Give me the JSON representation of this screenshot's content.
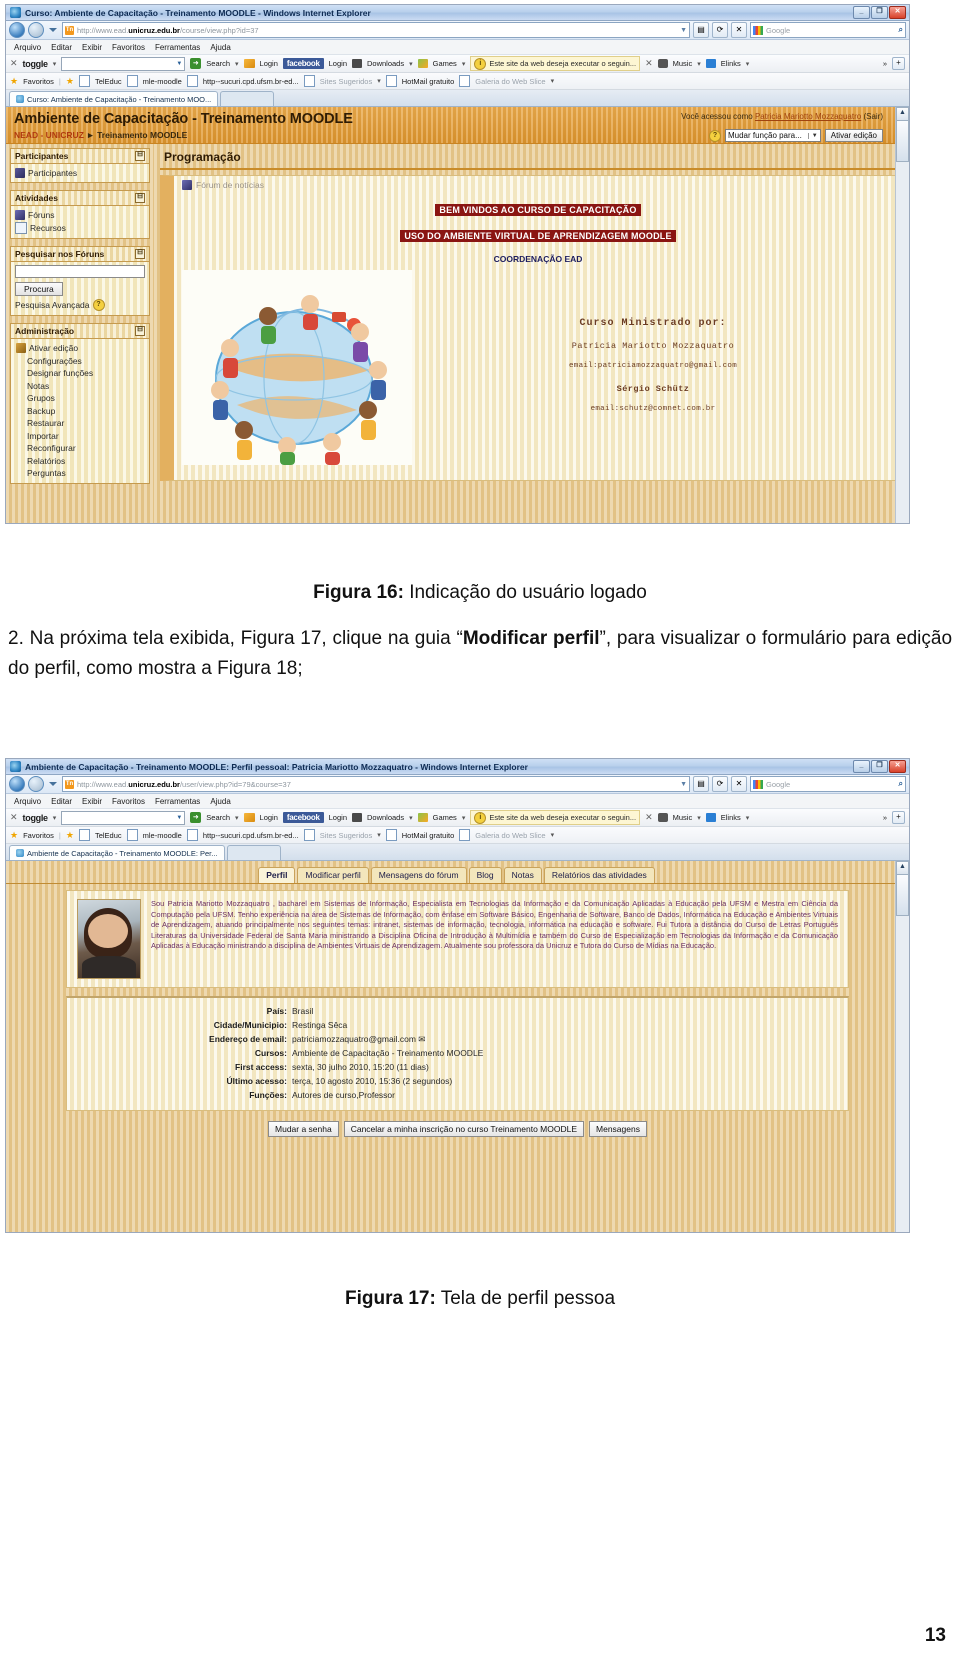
{
  "document": {
    "figure16_caption_bold": "Figura 16:",
    "figure16_caption_rest": " Indicação do usuário logado",
    "paragraph_part1": "2. Na próxima tela exibida, Figura 17, clique na guia “",
    "paragraph_bold": "Modificar perfil",
    "paragraph_part2": "”, para visualizar o formulário para edição do perfil, como mostra a Figura 18;",
    "figure17_caption_bold": "Figura 17:",
    "figure17_caption_rest": " Tela de perfil pessoa",
    "page_number": "13"
  },
  "shot1": {
    "window_title": "Curso: Ambiente de Capacitação - Treinamento MOODLE - Windows Internet Explorer",
    "win_minimize": "_",
    "win_restore": "❐",
    "win_close": "✕",
    "url_favicon": "Tn",
    "url_prefix": "http://www.ead.",
    "url_domain": "unicruz.edu.br",
    "url_suffix": "/course/view.php?id=37",
    "url_dropdown": "▼",
    "nav_refresh": "⟳",
    "nav_stop": "✕",
    "search_placeholder": "Google",
    "search_mag": "🔍",
    "menu": [
      "Arquivo",
      "Editar",
      "Exibir",
      "Favoritos",
      "Ferramentas",
      "Ajuda"
    ],
    "toolbar": {
      "close_x": "✕",
      "toggle_label": "toggle",
      "search_label": "Search",
      "login_label": "Login",
      "facebook_label": "facebook",
      "facebook_login_label": "Login",
      "downloads_label": "Downloads",
      "games_label": "Games",
      "notification": "Este site da web deseja executar o seguin...",
      "notification_close": "✕",
      "music_label": "Music",
      "elinks_label": "Elinks",
      "overflow": "»",
      "plus": "+"
    },
    "favbar": {
      "favorites_label": "Favoritos",
      "items": [
        "TelEduc",
        "mle-moodle",
        "http--sucuri.cpd.ufsm.br-ed...",
        "Sites Sugeridos",
        "HotMail gratuito",
        "Galeria do Web Slice"
      ]
    },
    "tab_label": "Curso: Ambiente de Capacitação - Treinamento MOO...",
    "moodle": {
      "site_title": "Ambiente de Capacitação - Treinamento MOODLE",
      "user_prefix": "Você acessou como ",
      "user_name": "Patricia Mariotto Mozzaquatro",
      "user_logout": " (Sair)",
      "breadcrumb_root": "NEAD - UNICRUZ",
      "breadcrumb_sep": "►",
      "breadcrumb_current": "Treinamento MOODLE",
      "help_icon": "?",
      "role_select": "Mudar função para...",
      "role_select_arrow": "▼",
      "edit_button": "Ativar edição",
      "blocks": [
        {
          "title": "Participantes",
          "minimize": "⊟",
          "items": [
            "Participantes"
          ]
        },
        {
          "title": "Atividades",
          "minimize": "⊟",
          "items": [
            "Fóruns",
            "Recursos"
          ]
        }
      ],
      "search_block": {
        "title": "Pesquisar nos Fóruns",
        "minimize": "⊟",
        "input_value": "",
        "button": "Procura",
        "advanced": "Pesquisa Avançada",
        "advanced_help": "?"
      },
      "admin_block": {
        "title": "Administração",
        "minimize": "⊟",
        "items": [
          "Ativar edição",
          "Configurações",
          "Designar funções",
          "Notas",
          "Grupos",
          "Backup",
          "Restaurar",
          "Importar",
          "Reconfigurar",
          "Relatórios",
          "Perguntas"
        ]
      },
      "section_title": "Programação",
      "news_forum": "Fórum de notícias",
      "banner1": "BEM VINDOS AO CURSO DE CAPACITAÇÃO",
      "banner2": "USO DO AMBIENTE VIRTUAL DE APRENDIZAGEM MOODLE",
      "coordination": "COORDENAÇÃO EAD",
      "credit_title": "Curso Ministrado por:",
      "credit_name1": "Patricia Mariotto Mozzaquatro",
      "credit_email1": "email:patriciamozzaquatro@gmail.com",
      "credit_name2": "Sérgio Schütz",
      "credit_email2": "email:schutz@comnet.com.br"
    },
    "scroll_up": "▲",
    "scroll_down": "▼"
  },
  "shot2": {
    "window_title": "Ambiente de Capacitação - Treinamento MOODLE: Perfil pessoal: Patricia Mariotto Mozzaquatro - Windows Internet Explorer",
    "win_minimize": "_",
    "win_restore": "❐",
    "win_close": "✕",
    "url_favicon": "Tn",
    "url_prefix": "http://www.ead.",
    "url_domain": "unicruz.edu.br",
    "url_suffix": "/user/view.php?id=79&course=37",
    "url_dropdown": "▼",
    "search_placeholder": "Google",
    "search_mag": "🔍",
    "menu": [
      "Arquivo",
      "Editar",
      "Exibir",
      "Favoritos",
      "Ferramentas",
      "Ajuda"
    ],
    "toolbar": {
      "close_x": "✕",
      "toggle_label": "toggle",
      "search_label": "Search",
      "login_label": "Login",
      "facebook_label": "facebook",
      "facebook_login_label": "Login",
      "downloads_label": "Downloads",
      "games_label": "Games",
      "notification": "Este site da web deseja executar o seguin...",
      "notification_close": "✕",
      "music_label": "Music",
      "elinks_label": "Elinks",
      "overflow": "»",
      "plus": "+"
    },
    "favbar": {
      "favorites_label": "Favoritos",
      "items": [
        "TelEduc",
        "mle-moodle",
        "http--sucuri.cpd.ufsm.br-ed...",
        "Sites Sugeridos",
        "HotMail gratuito",
        "Galeria do Web Slice"
      ]
    },
    "tab_label": "Ambiente de Capacitação - Treinamento MOODLE: Per...",
    "profile": {
      "tabs": [
        "Perfil",
        "Modificar perfil",
        "Mensagens do fórum",
        "Blog",
        "Notas",
        "Relatórios das atividades"
      ],
      "active_tab": "Perfil",
      "bio": "Sou Patricia Mariotto Mozzaquatro , bacharel em Sistemas de Informação, Especialista em Tecnologias da Informação e da Comunicação Aplicadas à Educação pela UFSM e Mestra em Ciência da Computação pela UFSM. Tenho experiência na área de Sistemas de Informação, com ênfase em Software Básico, Engenharia de Software, Banco de Dados, Informática na Educação e Ambientes Virtuais de Aprendizagem, atuando principalmente nos seguintes temas: intranet, sistemas de informação, tecnologia, informática na educação e software. Fui Tutora a distância do Curso de Letras Português Literaturas da Universidade Federal de Santa Maria ministrando a Disciplina Oficina de Introdução à Multimídia e também do Curso de Especialização em Tecnologias da Informação e da Comunicação Aplicadas à Educação ministrando a disciplina de Ambientes Virtuais de Aprendizagem. Atualmente sou professora da Unicruz e Tutora do Curso de Mídias na Educação.",
      "fields": [
        {
          "key": "País:",
          "value": "Brasil"
        },
        {
          "key": "Cidade/Municipio:",
          "value": "Restinga Sêca"
        },
        {
          "key": "Endereço de email:",
          "value": "patriciamozzaquatro@gmail.com ✉"
        },
        {
          "key": "Cursos:",
          "value": "Ambiente de Capacitação - Treinamento MOODLE"
        },
        {
          "key": "First access:",
          "value": "sexta, 30 julho 2010, 15:20  (11 dias)"
        },
        {
          "key": "Último acesso:",
          "value": "terça, 10 agosto 2010, 15:36  (2 segundos)"
        },
        {
          "key": "Funções:",
          "value": "Autores de curso,Professor"
        }
      ],
      "buttons": [
        "Mudar a senha",
        "Cancelar a minha inscrição no curso Treinamento MOODLE",
        "Mensagens"
      ]
    },
    "scroll_up": "▲",
    "scroll_down": "▼"
  }
}
